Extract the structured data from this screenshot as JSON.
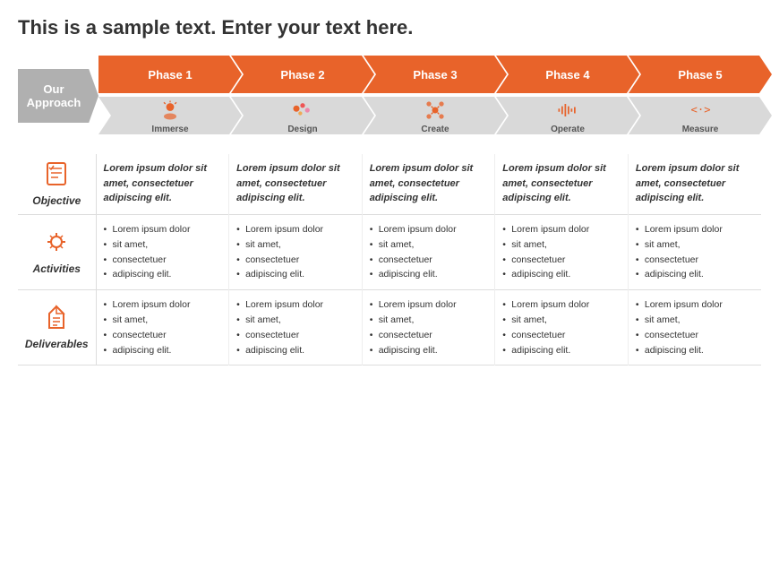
{
  "title": "This is a sample text. Enter your text here.",
  "approach_label": "Our\nApproach",
  "phases": [
    {
      "label": "Phase 1",
      "sublabel": "Immerse",
      "icon": "immerse"
    },
    {
      "label": "Phase 2",
      "sublabel": "Design",
      "icon": "design"
    },
    {
      "label": "Phase 3",
      "sublabel": "Create",
      "icon": "create"
    },
    {
      "label": "Phase 4",
      "sublabel": "Operate",
      "icon": "operate"
    },
    {
      "label": "Phase 5",
      "sublabel": "Measure",
      "icon": "measure"
    }
  ],
  "rows": [
    {
      "header_label": "Objective",
      "header_icon": "checklist-icon",
      "cells": [
        "Lorem ipsum dolor sit amet, consectetuer adipiscing elit.",
        "Lorem ipsum dolor sit amet, consectetuer adipiscing elit.",
        "Lorem ipsum dolor sit amet, consectetuer adipiscing elit.",
        "Lorem ipsum dolor sit amet, consectetuer adipiscing elit.",
        "Lorem ipsum dolor sit amet, consectetuer adipiscing elit."
      ],
      "type": "objective"
    },
    {
      "header_label": "Activities",
      "header_icon": "activities-icon",
      "cells": [
        [
          "Lorem ipsum dolor",
          "sit amet,",
          "consectetuer",
          "adipiscing elit."
        ],
        [
          "Lorem ipsum dolor",
          "sit amet,",
          "consectetuer",
          "adipiscing elit."
        ],
        [
          "Lorem ipsum dolor",
          "sit amet,",
          "consectetuer",
          "adipiscing elit."
        ],
        [
          "Lorem ipsum dolor",
          "sit amet,",
          "consectetuer",
          "adipiscing elit."
        ],
        [
          "Lorem ipsum dolor",
          "sit amet,",
          "consectetuer",
          "adipiscing elit."
        ]
      ],
      "type": "bullets"
    },
    {
      "header_label": "Deliverables",
      "header_icon": "deliverables-icon",
      "cells": [
        [
          "Lorem ipsum dolor",
          "sit amet,",
          "consectetuer",
          "adipiscing elit."
        ],
        [
          "Lorem ipsum dolor",
          "sit amet,",
          "consectetuer",
          "adipiscing elit."
        ],
        [
          "Lorem ipsum dolor",
          "sit amet,",
          "consectetuer",
          "adipiscing elit."
        ],
        [
          "Lorem ipsum dolor",
          "sit amet,",
          "consectetuer",
          "adipiscing elit."
        ],
        [
          "Lorem ipsum dolor",
          "sit amet,",
          "consectetuer",
          "adipiscing elit."
        ]
      ],
      "type": "bullets"
    }
  ],
  "colors": {
    "orange": "#e8632a",
    "gray": "#b0b0b0",
    "light_gray": "#d9d9d9"
  }
}
